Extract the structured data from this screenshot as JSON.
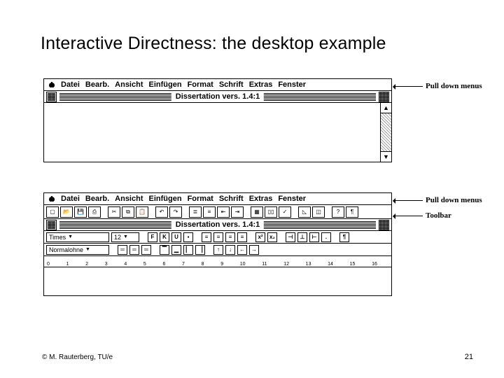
{
  "title": "Interactive Directness: the desktop example",
  "menus": [
    "Datei",
    "Bearb.",
    "Ansicht",
    "Einfügen",
    "Format",
    "Schrift",
    "Extras",
    "Fenster"
  ],
  "window_title": "Dissertation vers. 1.4:1",
  "annotations": {
    "a1": "Pull down menus",
    "a2": "Pull down menus",
    "a3": "Toolbar"
  },
  "formatting": {
    "font": "Times",
    "size": "12",
    "style_row_label": "Normalohne",
    "bold": "F",
    "italic": "K",
    "underline": "U"
  },
  "ruler_numbers": [
    "0",
    "1",
    "2",
    "3",
    "4",
    "5",
    "6",
    "7",
    "8",
    "9",
    "10",
    "11",
    "12",
    "13",
    "14",
    "15",
    "16"
  ],
  "footer_left": "© M. Rauterberg, TU/e",
  "footer_right": "21"
}
